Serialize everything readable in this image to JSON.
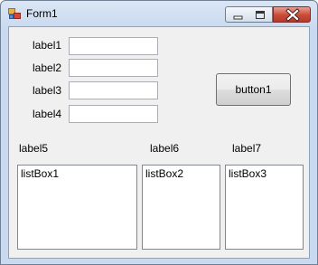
{
  "window": {
    "title": "Form1"
  },
  "labels": {
    "label1": "label1",
    "label2": "label2",
    "label3": "label3",
    "label4": "label4",
    "label5": "label5",
    "label6": "label6",
    "label7": "label7"
  },
  "textboxes": {
    "textbox1": {
      "value": ""
    },
    "textbox2": {
      "value": ""
    },
    "textbox3": {
      "value": ""
    },
    "textbox4": {
      "value": ""
    }
  },
  "button1": {
    "label": "button1"
  },
  "listboxes": {
    "listBox1": "listBox1",
    "listBox2": "listBox2",
    "listBox3": "listBox3"
  },
  "icons": {
    "app": "form-icon",
    "minimize": "minimize-icon",
    "maximize": "maximize-icon",
    "close": "close-icon"
  }
}
